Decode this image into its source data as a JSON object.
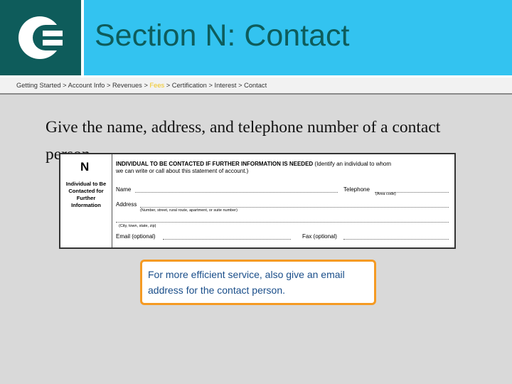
{
  "header": {
    "title": "Section N: Contact",
    "logo_icon": "c-logo-icon"
  },
  "breadcrumb": {
    "items": [
      "Getting Started",
      "Account Info",
      "Revenues",
      "Fees",
      "Certification",
      "Interest",
      "Contact"
    ],
    "separator": ">",
    "active": "Fees"
  },
  "instruction": "Give the name, address, and telephone number of a contact person.",
  "form": {
    "section_letter": "N",
    "side_label": "Individual to Be Contacted for Further Information",
    "heading_bold": "INDIVIDUAL TO BE CONTACTED IF FURTHER INFORMATION IS NEEDED",
    "heading_rest_1": "(Identify an individual to whom",
    "heading_rest_2": "we can write or call about this statement of account.)",
    "name_label": "Name",
    "telephone_label": "Telephone",
    "area_code_note": "(Area code)",
    "address_label": "Address",
    "address_hint_1": "(Number, street, rural route, apartment, or suite number)",
    "address_hint_2": "(City, town, state, zip)",
    "email_label": "Email (optional)",
    "fax_label": "Fax (optional)"
  },
  "callout": {
    "text": "For more efficient service, also give an email address for the contact person."
  },
  "colors": {
    "logo_bg": "#0e5c5b",
    "header_bg": "#33c3f0",
    "title_text": "#0e5c5b",
    "breadcrumb_active": "#f0c419",
    "callout_border": "#f59a23",
    "callout_text": "#1a4e8a"
  }
}
